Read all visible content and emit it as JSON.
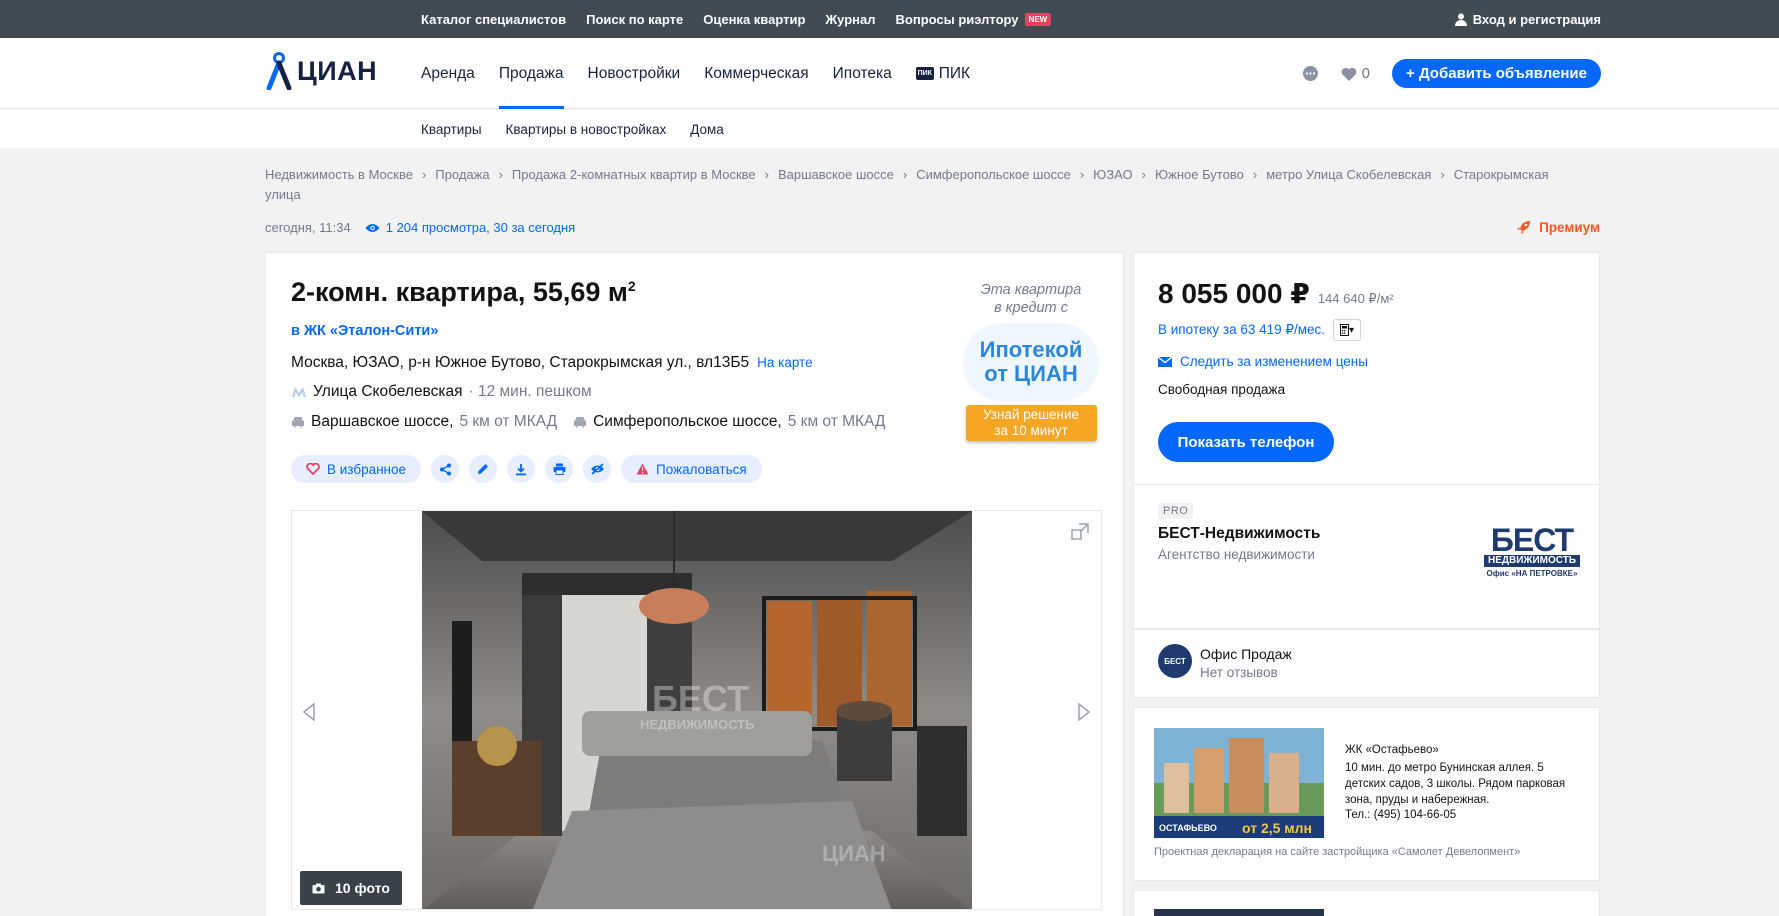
{
  "topbar": {
    "links": [
      "Каталог специалистов",
      "Поиск по карте",
      "Оценка квартир",
      "Журнал",
      "Вопросы риэлтору"
    ],
    "new_badge": "NEW",
    "login": "Вход и регистрация"
  },
  "logo": {
    "text": "ЦИАН"
  },
  "nav": {
    "items": [
      "Аренда",
      "Продажа",
      "Новостройки",
      "Коммерческая",
      "Ипотека",
      "ПИК"
    ],
    "active_index": 1,
    "favorites_count": "0",
    "add_button": "+ Добавить объявление"
  },
  "subnav": {
    "items": [
      "Квартиры",
      "Квартиры в новостройках",
      "Дома"
    ]
  },
  "breadcrumb": [
    "Недвижимость в Москве",
    "Продажа",
    "Продажа 2-комнатных квартир в Москве",
    "Варшавское шоссе",
    "Симферопольское шоссе",
    "ЮЗАО",
    "Южное Бутово",
    "метро Улица Скобелевская",
    "Старокрымская улица"
  ],
  "meta": {
    "date": "сегодня, 11:34",
    "views": "1 204 просмотра, 30 за сегодня",
    "premium": "Премиум"
  },
  "listing": {
    "title": "2-комн. квартира, 55,69 м",
    "title_sup": "2",
    "jk": "в ЖК «Эталон-Сити»",
    "address": "Москва, ЮЗАО, р-н Южное Бутово, Старокрымская ул., вл13Б5",
    "map_link": "На карте",
    "metro": "Улица Скобелевская",
    "metro_walk": "· 12 мин. пешком",
    "highways": [
      {
        "name": "Варшавское шоссе,",
        "dist": "5 км от МКАД"
      },
      {
        "name": "Симферопольское шоссе,",
        "dist": "5 км от МКАД"
      }
    ],
    "favorite": "В избранное",
    "complain": "Пожаловаться",
    "photo_count": "10 фото"
  },
  "promo": {
    "line1": "Эта квартира",
    "line2": "в кредит с",
    "brand1": "Ипотекой",
    "brand2": "от ЦИАН",
    "cta1": "Узнай решение",
    "cta2": "за 10 минут"
  },
  "price": {
    "main": "8 055 000 ₽",
    "per_meter": "144 640 ₽/м²",
    "mortgage": "В ипотеку за 63 419 ₽/мес.",
    "follow": "Следить за изменением цены",
    "sale_type": "Свободная продажа",
    "phone_button": "Показать телефон"
  },
  "agency": {
    "badge": "PRO",
    "name": "БЕСТ-Недвижимость",
    "type": "Агентство недвижимости",
    "logo_line1": "БЕСТ",
    "logo_line2": "НЕДВИЖИМОСТЬ",
    "logo_line3": "Офис «НА ПЕТРОВКЕ»"
  },
  "office": {
    "avatar": "БЕСТ",
    "name": "Офис Продаж",
    "reviews": "Нет отзывов"
  },
  "ad": {
    "title": "ЖК «Остафьево»",
    "desc": "10 мин. до метро Бунинская аллея. 5 детских садов, 3 школы. Рядом парковая зона, пруды и набережная.",
    "phone": "Тел.: (495) 104-66-05",
    "banner_brand": "ОСТАФЬЕВО",
    "banner_price": "от 2,5 млн",
    "footer": "Проектная декларация на сайте застройщика «Самолет Девелопмент»"
  },
  "colors": {
    "accent": "#0468ff",
    "topbar": "#414b54",
    "promo_orange": "#f5a623"
  }
}
